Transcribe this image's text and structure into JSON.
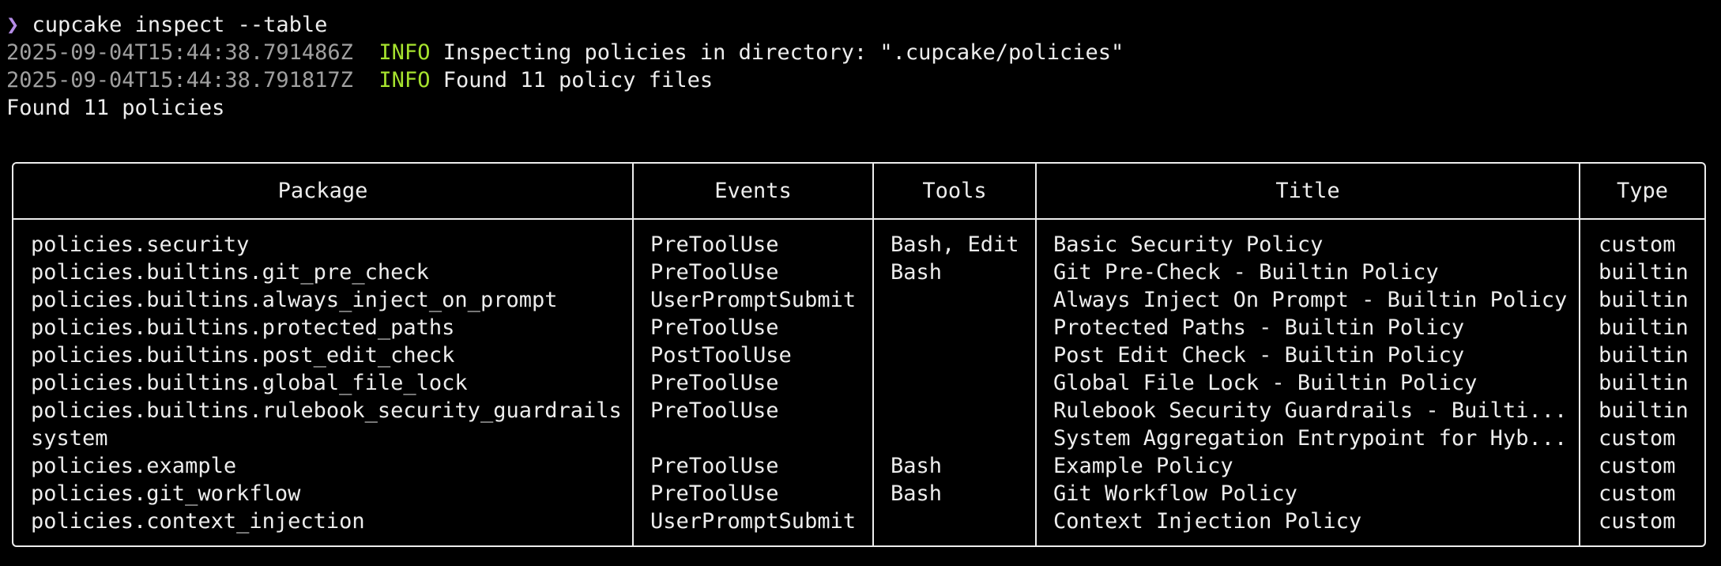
{
  "terminal": {
    "prompt_symbol": "❯",
    "command": "cupcake inspect --table",
    "log_lines": [
      {
        "timestamp": "2025-09-04T15:44:38.791486Z",
        "level": "INFO",
        "message": "Inspecting policies in directory: \".cupcake/policies\""
      },
      {
        "timestamp": "2025-09-04T15:44:38.791817Z",
        "level": "INFO",
        "message": "Found 11 policy files"
      }
    ],
    "summary": "Found 11 policies"
  },
  "table": {
    "headers": [
      "Package",
      "Events",
      "Tools",
      "Title",
      "Type"
    ],
    "rows": [
      [
        "policies.security",
        "PreToolUse",
        "Bash, Edit",
        "Basic Security Policy",
        "custom"
      ],
      [
        "policies.builtins.git_pre_check",
        "PreToolUse",
        "Bash",
        "Git Pre-Check - Builtin Policy",
        "builtin"
      ],
      [
        "policies.builtins.always_inject_on_prompt",
        "UserPromptSubmit",
        "",
        "Always Inject On Prompt - Builtin Policy",
        "builtin"
      ],
      [
        "policies.builtins.protected_paths",
        "PreToolUse",
        "",
        "Protected Paths - Builtin Policy",
        "builtin"
      ],
      [
        "policies.builtins.post_edit_check",
        "PostToolUse",
        "",
        "Post Edit Check - Builtin Policy",
        "builtin"
      ],
      [
        "policies.builtins.global_file_lock",
        "PreToolUse",
        "",
        "Global File Lock - Builtin Policy",
        "builtin"
      ],
      [
        "policies.builtins.rulebook_security_guardrails",
        "PreToolUse",
        "",
        "Rulebook Security Guardrails - Builti...",
        "builtin"
      ],
      [
        "system",
        "",
        "",
        "System Aggregation Entrypoint for Hyb...",
        "custom"
      ],
      [
        "policies.example",
        "PreToolUse",
        "Bash",
        "Example Policy",
        "custom"
      ],
      [
        "policies.git_workflow",
        "PreToolUse",
        "Bash",
        "Git Workflow Policy",
        "custom"
      ],
      [
        "policies.context_injection",
        "UserPromptSubmit",
        "",
        "Context Injection Policy",
        "custom"
      ]
    ]
  },
  "colors": {
    "background": "#000000",
    "text": "#ededed",
    "timestamp": "#a0a0a0",
    "info_level": "#a6e22e",
    "prompt_symbol": "#b48ce6"
  }
}
